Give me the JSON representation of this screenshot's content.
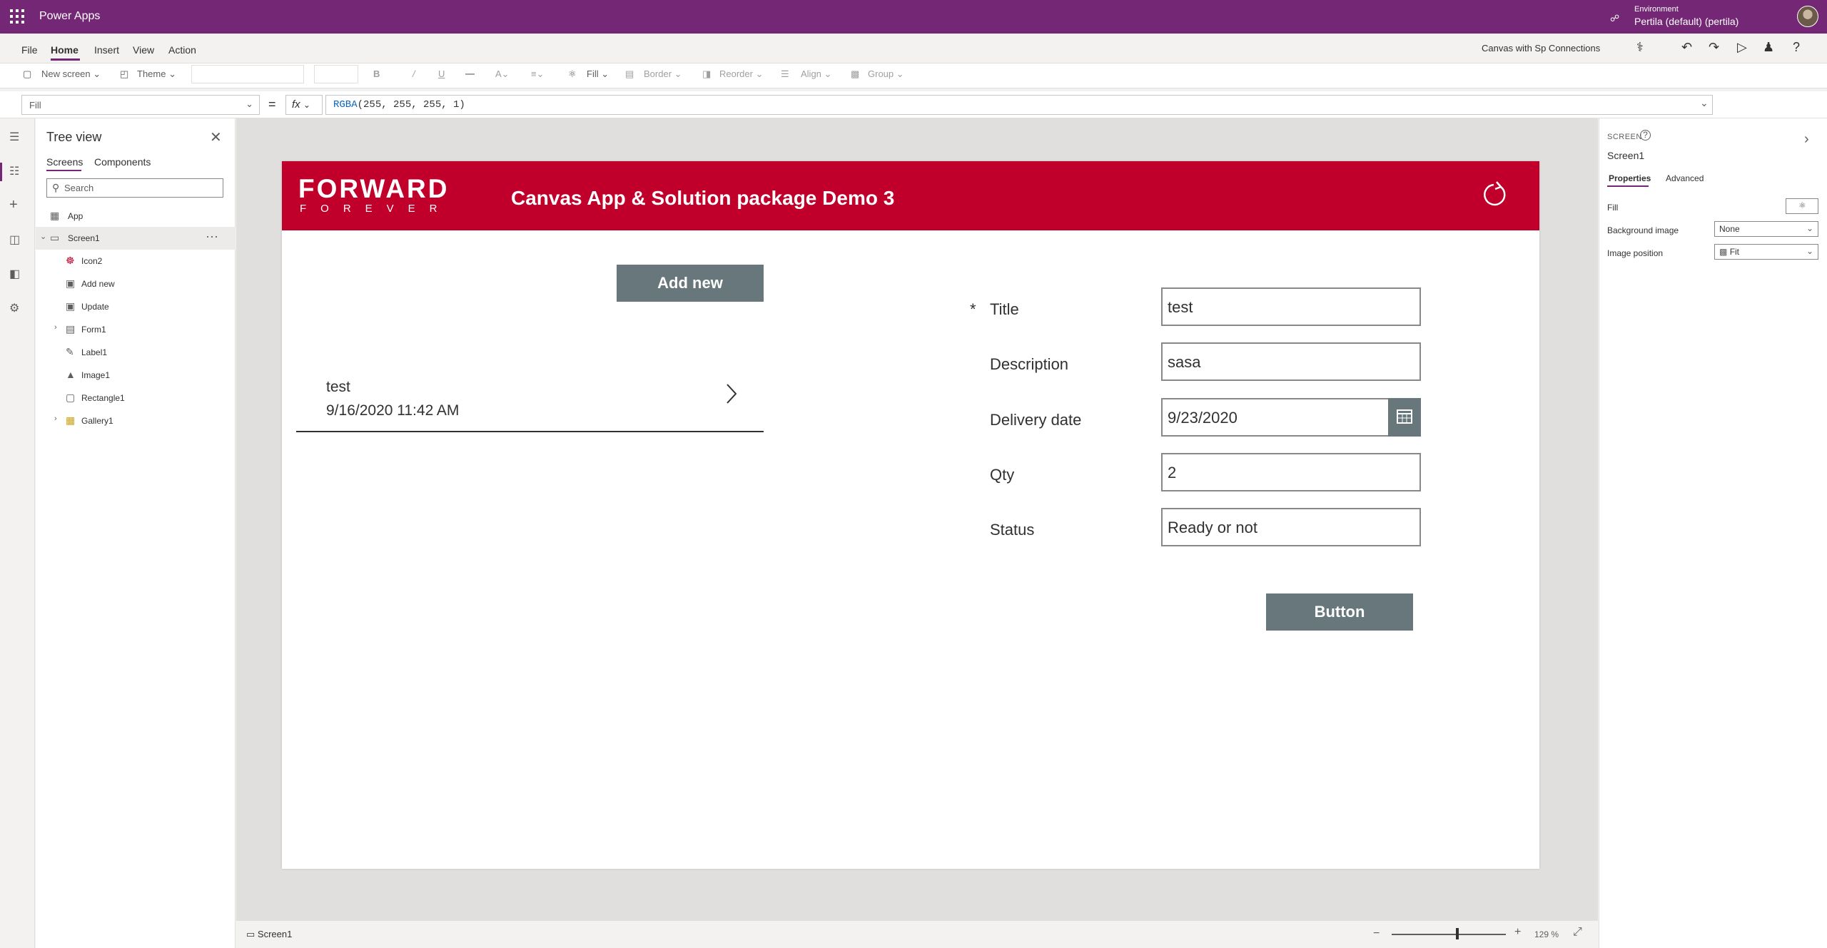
{
  "topbar": {
    "app_name": "Power Apps",
    "env_label": "Environment",
    "env_value": "Pertila (default) (pertila)"
  },
  "menu": {
    "items": [
      "File",
      "Home",
      "Insert",
      "View",
      "Action"
    ],
    "active": "Home",
    "app_title_right": "Canvas with Sp Connections"
  },
  "ribbon": {
    "new_screen": "New screen",
    "theme": "Theme",
    "fill": "Fill",
    "border": "Border",
    "reorder": "Reorder",
    "align": "Align",
    "group": "Group"
  },
  "formula_bar": {
    "property": "Fill",
    "equals": "=",
    "fx": "fx",
    "formula_fn": "RGBA",
    "formula_args": "(255, 255, 255, 1)"
  },
  "tree": {
    "title": "Tree view",
    "tabs": [
      "Screens",
      "Components"
    ],
    "search_placeholder": "Search",
    "items": [
      {
        "label": "App",
        "icon": "app-icon"
      },
      {
        "label": "Screen1",
        "icon": "screen-icon"
      },
      {
        "label": "Icon2",
        "icon": "icon-control-icon"
      },
      {
        "label": "Add new",
        "icon": "button-icon"
      },
      {
        "label": "Update",
        "icon": "button-icon"
      },
      {
        "label": "Form1",
        "icon": "form-icon"
      },
      {
        "label": "Label1",
        "icon": "label-icon"
      },
      {
        "label": "Image1",
        "icon": "image-icon"
      },
      {
        "label": "Rectangle1",
        "icon": "rectangle-icon"
      },
      {
        "label": "Gallery1",
        "icon": "gallery-icon"
      }
    ]
  },
  "canvas": {
    "logo_top": "FORWARD",
    "logo_bottom": "FOREVER",
    "title": "Canvas App & Solution package Demo 3",
    "add_new_label": "Add new",
    "gallery_item": {
      "title": "test",
      "subtitle": "9/16/2020 11:42 AM"
    },
    "form": {
      "required_marker": "*",
      "fields": [
        {
          "label": "Title",
          "value": "test"
        },
        {
          "label": "Description",
          "value": "sasa"
        },
        {
          "label": "Delivery date",
          "value": "9/23/2020"
        },
        {
          "label": "Qty",
          "value": "2"
        },
        {
          "label": "Status",
          "value": "Ready or not"
        }
      ]
    },
    "button_label": "Button",
    "header_color": "#c0002a",
    "button_color": "#68777b"
  },
  "statusbar": {
    "screen": "Screen1",
    "zoom": "129 %"
  },
  "properties": {
    "kind": "SCREEN",
    "name": "Screen1",
    "tabs": [
      "Properties",
      "Advanced"
    ],
    "fill_label": "Fill",
    "bg_image_label": "Background image",
    "bg_image_value": "None",
    "image_position_label": "Image position",
    "image_position_value": "Fit"
  }
}
